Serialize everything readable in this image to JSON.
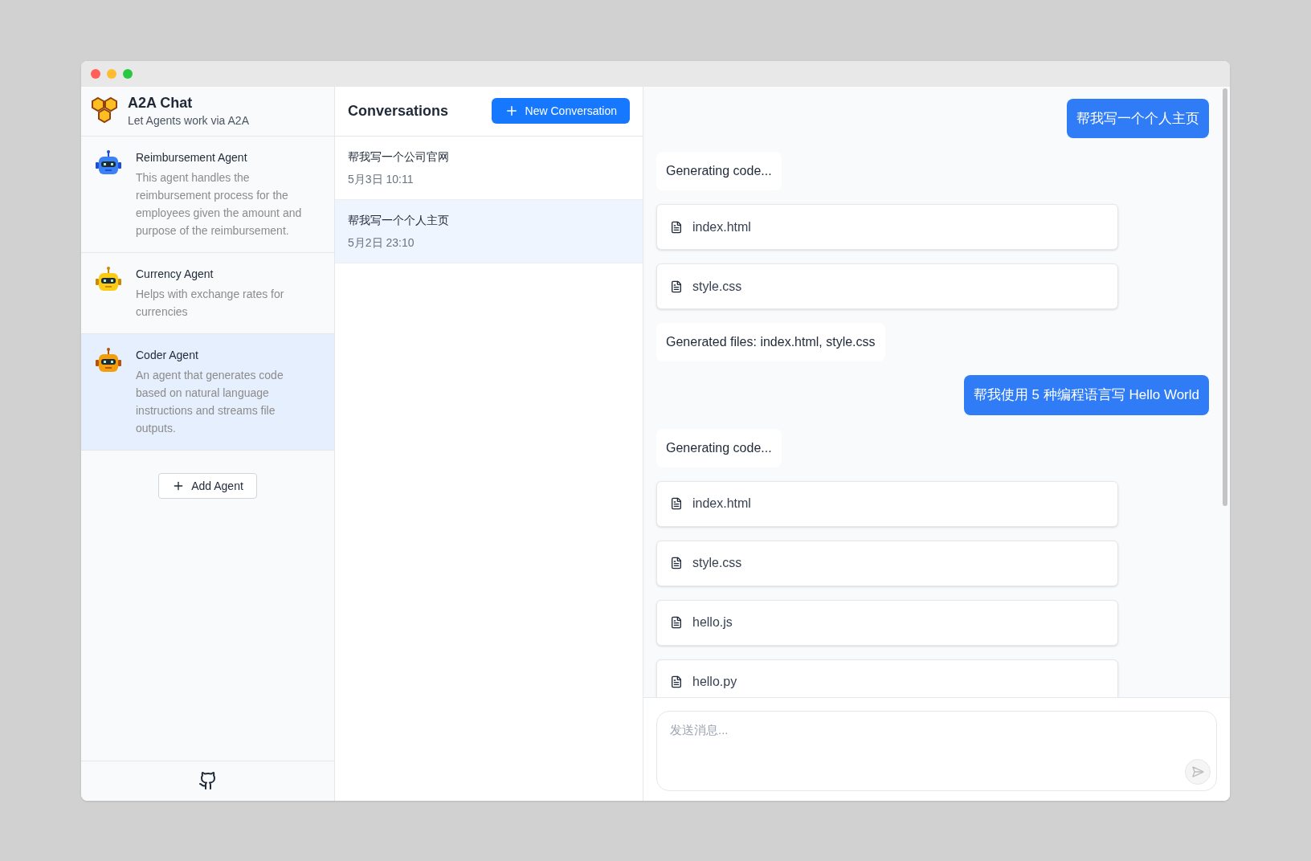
{
  "app": {
    "title": "A2A Chat",
    "subtitle": "Let Agents work via A2A"
  },
  "agents": [
    {
      "name": "Reimbursement Agent",
      "description": "This agent handles the reimbursement process for the employees given the amount and purpose of the reimbursement.",
      "kind": "blue",
      "selected": false
    },
    {
      "name": "Currency Agent",
      "description": "Helps with exchange rates for currencies",
      "kind": "yellow",
      "selected": false
    },
    {
      "name": "Coder Agent",
      "description": "An agent that generates code based on natural language instructions and streams file outputs.",
      "kind": "orange",
      "selected": true
    }
  ],
  "add_agent": "Add Agent",
  "conversations": {
    "title": "Conversations",
    "new_button": "New Conversation",
    "items": [
      {
        "title": "帮我写一个公司官网",
        "time": "5月3日 10:11",
        "selected": false
      },
      {
        "title": "帮我写一个个人主页",
        "time": "5月2日 23:10",
        "selected": true
      }
    ]
  },
  "messages": [
    {
      "kind": "user",
      "text": "帮我写一个个人主页"
    },
    {
      "kind": "text",
      "text": "Generating code..."
    },
    {
      "kind": "file",
      "text": "index.html"
    },
    {
      "kind": "file",
      "text": "style.css"
    },
    {
      "kind": "text",
      "text": "Generated files: index.html, style.css"
    },
    {
      "kind": "user",
      "text": "帮我使用 5 种编程语言写 Hello World"
    },
    {
      "kind": "text",
      "text": "Generating code..."
    },
    {
      "kind": "file",
      "text": "index.html"
    },
    {
      "kind": "file",
      "text": "style.css"
    },
    {
      "kind": "file",
      "text": "hello.js"
    },
    {
      "kind": "file",
      "text": "hello.py"
    }
  ],
  "composer": {
    "placeholder": "发送消息..."
  }
}
